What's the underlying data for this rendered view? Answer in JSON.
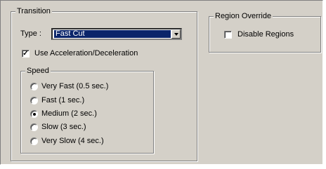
{
  "transition": {
    "title": "Transition",
    "type_label": "Type :",
    "type_value": "Fast Cut",
    "accel_label": "Use Acceleration/Deceleration",
    "accel_checked": true,
    "speed": {
      "title": "Speed",
      "selected": "Medium (2 sec.)",
      "options": [
        "Very Fast (0.5 sec.)",
        "Fast (1 sec.)",
        "Medium (2 sec.)",
        "Slow (3 sec.)",
        "Very Slow (4 sec.)"
      ]
    }
  },
  "region_override": {
    "title": "Region Override",
    "disable_label": "Disable Regions",
    "disable_checked": false
  },
  "colors": {
    "dialog_bg": "#d4d0c8",
    "selection_bg": "#0a246a"
  }
}
